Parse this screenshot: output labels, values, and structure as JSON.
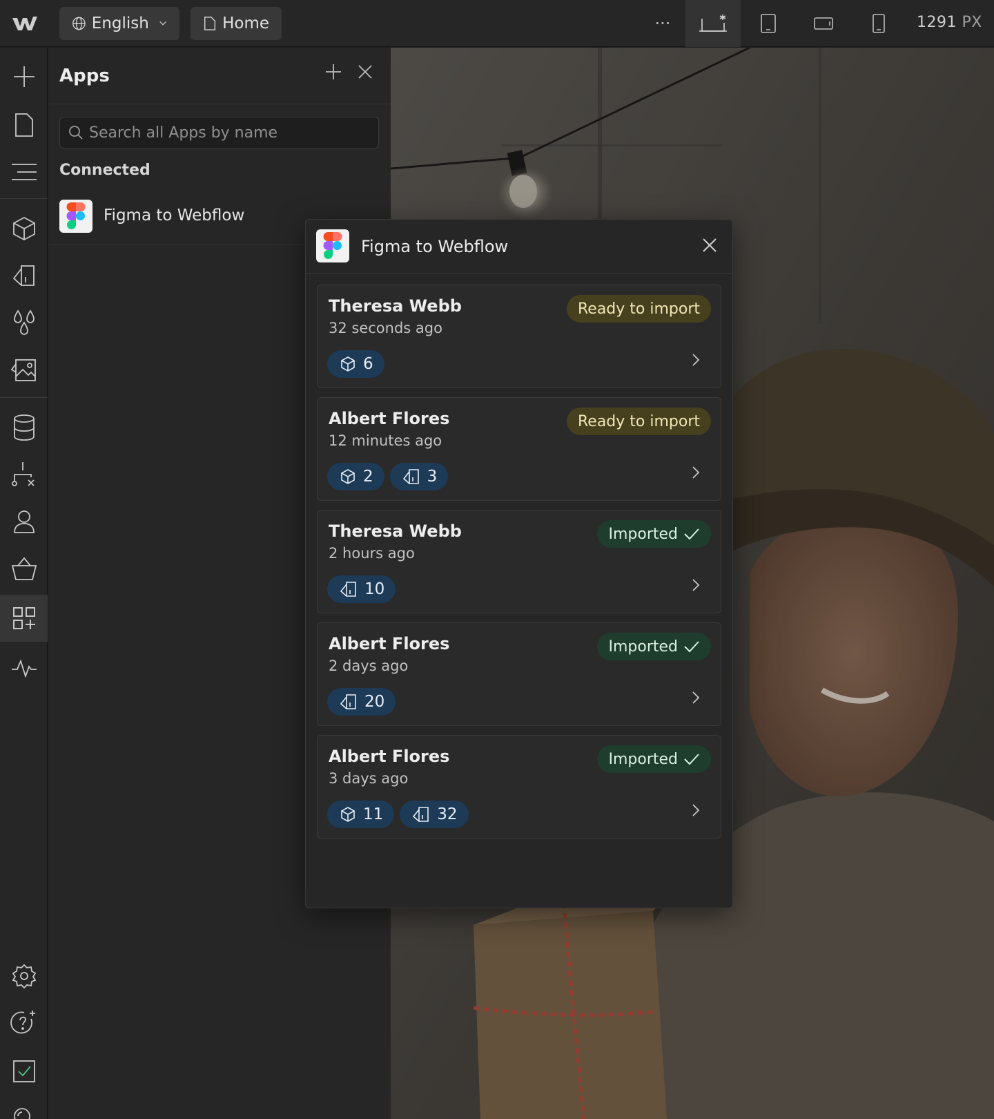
{
  "topbar": {
    "language_label": "English",
    "page_label": "Home",
    "more_label": "···",
    "canvas_width": "1291",
    "canvas_unit": "PX"
  },
  "apps_panel": {
    "title": "Apps",
    "search_placeholder": "Search all Apps by name",
    "connected_label": "Connected",
    "connected_apps": [
      {
        "name": "Figma to Webflow"
      }
    ]
  },
  "popup": {
    "title": "Figma to Webflow",
    "imports": [
      {
        "name": "Theresa Webb",
        "time": "32 seconds ago",
        "status": "Ready to import",
        "status_kind": "ready",
        "chips": [
          {
            "icon": "component-icon",
            "count": "6"
          }
        ]
      },
      {
        "name": "Albert Flores",
        "time": "12 minutes ago",
        "status": "Ready to import",
        "status_kind": "ready",
        "chips": [
          {
            "icon": "component-icon",
            "count": "2"
          },
          {
            "icon": "style-icon",
            "count": "3"
          }
        ]
      },
      {
        "name": "Theresa Webb",
        "time": "2 hours ago",
        "status": "Imported",
        "status_kind": "imported",
        "chips": [
          {
            "icon": "style-icon",
            "count": "10"
          }
        ]
      },
      {
        "name": "Albert Flores",
        "time": "2 days ago",
        "status": "Imported",
        "status_kind": "imported",
        "chips": [
          {
            "icon": "style-icon",
            "count": "20"
          }
        ]
      },
      {
        "name": "Albert Flores",
        "time": "3 days ago",
        "status": "Imported",
        "status_kind": "imported",
        "chips": [
          {
            "icon": "component-icon",
            "count": "11"
          },
          {
            "icon": "style-icon",
            "count": "32"
          }
        ]
      }
    ]
  },
  "colors": {
    "ready_badge_bg": "#47401f",
    "imported_badge_bg": "#1f3d2c",
    "chip_bg": "#1d3a57",
    "panel_bg": "#262626"
  }
}
